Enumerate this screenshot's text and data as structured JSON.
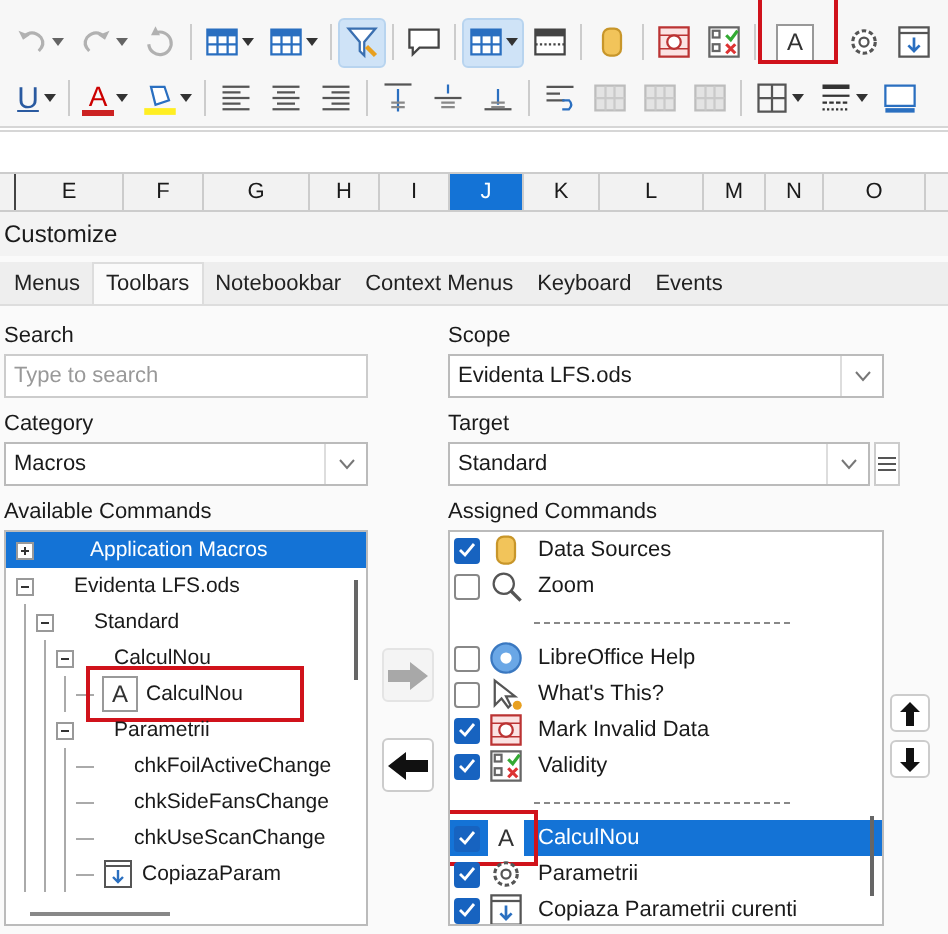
{
  "toolbar_rows": [
    [
      {
        "kind": "undo",
        "disabled": true,
        "menu": true
      },
      {
        "kind": "redo",
        "disabled": true,
        "menu": true
      },
      {
        "kind": "refresh",
        "disabled": true
      },
      {
        "kind": "sep"
      },
      {
        "kind": "table",
        "menu": true
      },
      {
        "kind": "table",
        "menu": true
      },
      {
        "kind": "sep"
      },
      {
        "kind": "filter",
        "on": true
      },
      {
        "kind": "sep"
      },
      {
        "kind": "comment"
      },
      {
        "kind": "sep"
      },
      {
        "kind": "form",
        "on": true,
        "menu": true
      },
      {
        "kind": "header"
      },
      {
        "kind": "sep"
      },
      {
        "kind": "database"
      },
      {
        "kind": "sep"
      },
      {
        "kind": "invalid"
      },
      {
        "kind": "validity"
      },
      {
        "kind": "sep"
      },
      {
        "kind": "glyph",
        "glyph": "A",
        "highlighted": true
      },
      {
        "kind": "gear"
      },
      {
        "kind": "download"
      }
    ],
    [
      {
        "kind": "underline",
        "glyph": "U",
        "menu": true
      },
      {
        "kind": "sep"
      },
      {
        "kind": "fontcolor",
        "glyph": "A",
        "menu": true
      },
      {
        "kind": "highlight",
        "menu": true
      },
      {
        "kind": "sep"
      },
      {
        "kind": "align-left"
      },
      {
        "kind": "align-center"
      },
      {
        "kind": "align-right"
      },
      {
        "kind": "sep"
      },
      {
        "kind": "valign-top"
      },
      {
        "kind": "valign-center"
      },
      {
        "kind": "valign-bottom"
      },
      {
        "kind": "sep"
      },
      {
        "kind": "wrap"
      },
      {
        "kind": "merge",
        "disabled": true
      },
      {
        "kind": "merge",
        "disabled": true
      },
      {
        "kind": "merge",
        "disabled": true
      },
      {
        "kind": "sep"
      },
      {
        "kind": "borders",
        "menu": true
      },
      {
        "kind": "linestyle",
        "menu": true
      },
      {
        "kind": "monitor"
      }
    ]
  ],
  "columns": [
    {
      "label": "E",
      "selected": false
    },
    {
      "label": "F",
      "selected": false
    },
    {
      "label": "G",
      "selected": false
    },
    {
      "label": "H",
      "selected": false
    },
    {
      "label": "I",
      "selected": false
    },
    {
      "label": "J",
      "selected": true
    },
    {
      "label": "K",
      "selected": false
    },
    {
      "label": "L",
      "selected": false
    },
    {
      "label": "M",
      "selected": false
    },
    {
      "label": "N",
      "selected": false
    },
    {
      "label": "O",
      "selected": false
    }
  ],
  "dialog": {
    "title": "Customize",
    "tabs": [
      {
        "label": "Menus",
        "selected": false
      },
      {
        "label": "Toolbars",
        "selected": true
      },
      {
        "label": "Notebookbar",
        "selected": false
      },
      {
        "label": "Context Menus",
        "selected": false
      },
      {
        "label": "Keyboard",
        "selected": false
      },
      {
        "label": "Events",
        "selected": false
      }
    ],
    "search": {
      "label": "Search",
      "placeholder": "Type to search"
    },
    "category": {
      "label": "Category",
      "value": "Macros"
    },
    "available_commands": {
      "label": "Available Commands",
      "items": [
        {
          "label": "Application Macros",
          "expanded": false,
          "selected": true
        },
        {
          "label": "Evidenta LFS.ods",
          "expanded": true,
          "selected": false,
          "children": [
            {
              "label": "Standard",
              "expanded": true,
              "selected": false,
              "children": [
                {
                  "label": "CalculNou",
                  "expanded": true,
                  "selected": false,
                  "children": [
                    {
                      "label": "CalculNou",
                      "selected": false,
                      "kind": "glyph",
                      "glyph": "A",
                      "highlighted": true
                    }
                  ]
                },
                {
                  "label": "Parametrii",
                  "expanded": true,
                  "selected": false,
                  "children": [
                    {
                      "label": "chkFoilActiveChange",
                      "selected": false
                    },
                    {
                      "label": "chkSideFansChange",
                      "selected": false
                    },
                    {
                      "label": "chkUseScanChange",
                      "selected": false
                    },
                    {
                      "label": "CopiazaParam",
                      "selected": false,
                      "kind": "download"
                    }
                  ]
                }
              ]
            }
          ]
        }
      ]
    },
    "scope": {
      "label": "Scope",
      "value": "Evidenta LFS.ods"
    },
    "target": {
      "label": "Target",
      "value": "Standard"
    },
    "assigned_commands": {
      "label": "Assigned Commands",
      "items": [
        {
          "kind": "database",
          "label": "Data Sources",
          "checked": true,
          "selected": false
        },
        {
          "kind": "zoom",
          "label": "Zoom",
          "checked": false,
          "selected": false
        },
        {
          "kind": "separator"
        },
        {
          "kind": "help",
          "label": "LibreOffice Help",
          "checked": false,
          "selected": false
        },
        {
          "kind": "whatsthis",
          "label": "What's This?",
          "checked": false,
          "selected": false
        },
        {
          "kind": "invalid",
          "label": "Mark Invalid Data",
          "checked": true,
          "selected": false
        },
        {
          "kind": "validity",
          "label": "Validity",
          "checked": true,
          "selected": false
        },
        {
          "kind": "separator"
        },
        {
          "kind": "glyph",
          "glyph": "A",
          "label": "CalculNou",
          "checked": true,
          "selected": true,
          "highlighted": true
        },
        {
          "kind": "gear",
          "label": "Parametrii",
          "checked": true,
          "selected": false
        },
        {
          "kind": "download",
          "label": "Copiaza Parametrii curenti",
          "checked": true,
          "selected": false
        }
      ]
    },
    "add_button": {
      "disabled": true
    },
    "remove_button": {
      "disabled": false
    }
  }
}
